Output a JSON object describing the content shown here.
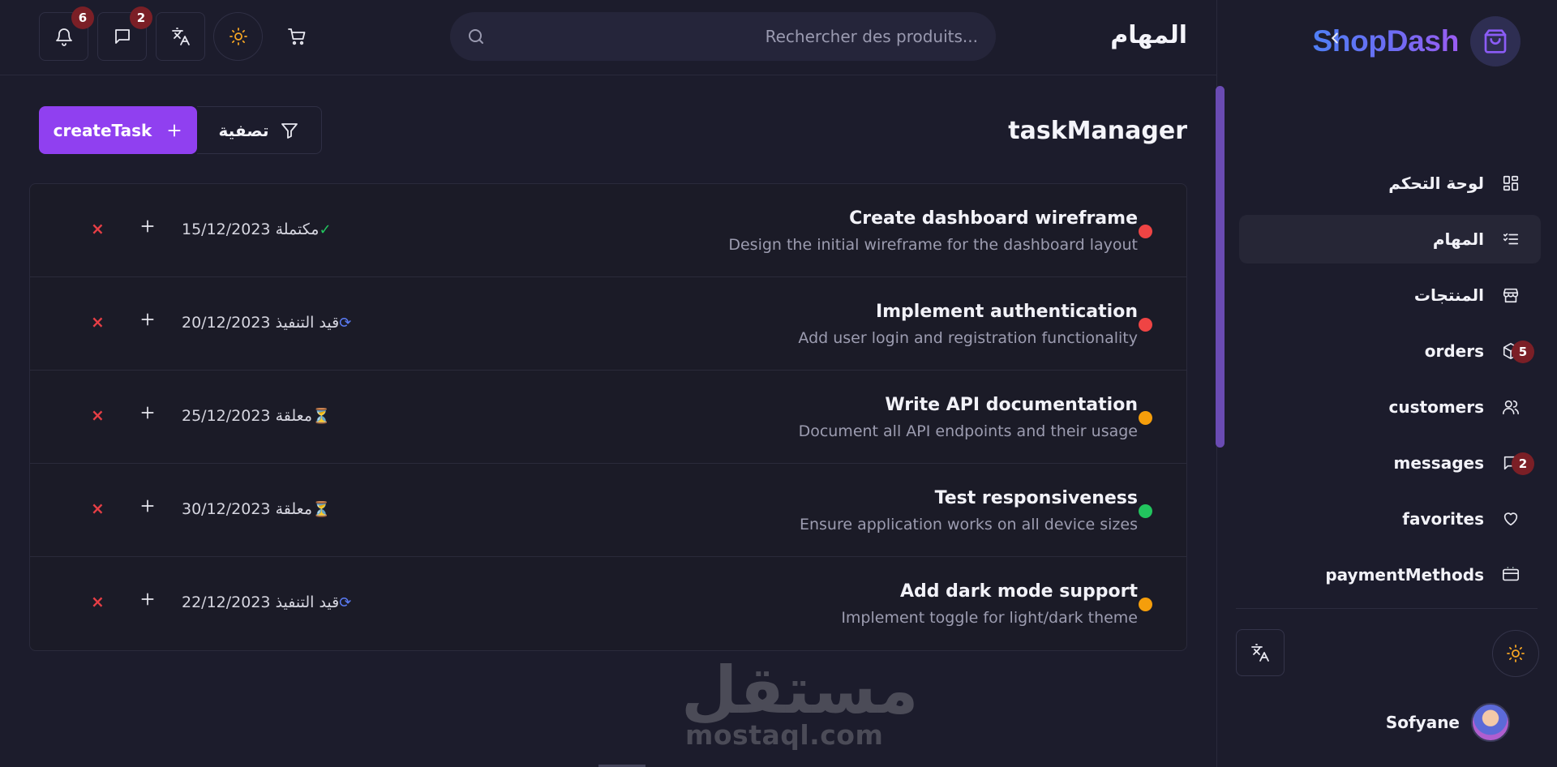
{
  "brand": {
    "name": "ShopDash"
  },
  "header": {
    "title": "المهام",
    "search_placeholder": "Rechercher des produits...",
    "notifications_count": "6",
    "messages_count": "2"
  },
  "sidebar": {
    "items": [
      {
        "label": "لوحة التحكم",
        "icon": "grid-icon",
        "active": false
      },
      {
        "label": "المهام",
        "icon": "checklist-icon",
        "active": true
      },
      {
        "label": "المنتجات",
        "icon": "store-icon",
        "active": false
      },
      {
        "label": "orders",
        "icon": "box-icon",
        "badge": "5"
      },
      {
        "label": "customers",
        "icon": "users-icon"
      },
      {
        "label": "messages",
        "icon": "message-icon",
        "badge": "2"
      },
      {
        "label": "favorites",
        "icon": "heart-icon"
      },
      {
        "label": "paymentMethods",
        "icon": "credit-card-icon"
      }
    ],
    "user": {
      "name": "Sofyane"
    }
  },
  "main": {
    "section_title": "taskManager",
    "create_label": "createTask",
    "filter_label": "تصفية"
  },
  "tasks": [
    {
      "title": "Create dashboard wireframe",
      "description": "Design the initial wireframe for the dashboard layout",
      "priority_color": "#ef4444",
      "status_icon": "✓",
      "status_label": "مكتملة",
      "status_color": "#22c55e",
      "date": "15/12/2023"
    },
    {
      "title": "Implement authentication",
      "description": "Add user login and registration functionality",
      "priority_color": "#ef4444",
      "status_icon": "⟳",
      "status_label": "قيد التنفيذ",
      "status_color": "#5b7cf6",
      "date": "20/12/2023"
    },
    {
      "title": "Write API documentation",
      "description": "Document all API endpoints and their usage",
      "priority_color": "#f59e0b",
      "status_icon": "⏳",
      "status_label": "معلقة",
      "status_color": "#e0a030",
      "date": "25/12/2023"
    },
    {
      "title": "Test responsiveness",
      "description": "Ensure application works on all device sizes",
      "priority_color": "#22c55e",
      "status_icon": "⏳",
      "status_label": "معلقة",
      "status_color": "#e0a030",
      "date": "30/12/2023"
    },
    {
      "title": "Add dark mode support",
      "description": "Implement toggle for light/dark theme",
      "priority_color": "#f59e0b",
      "status_icon": "⟳",
      "status_label": "قيد التنفيذ",
      "status_color": "#5b7cf6",
      "date": "22/12/2023"
    }
  ],
  "watermark": {
    "arabic": "مستقل",
    "latin": "mostaql.com"
  },
  "colors": {
    "accent": "#9040f0",
    "badge": "#7b1f26",
    "danger": "#e53e45",
    "sun": "#f5a524"
  }
}
